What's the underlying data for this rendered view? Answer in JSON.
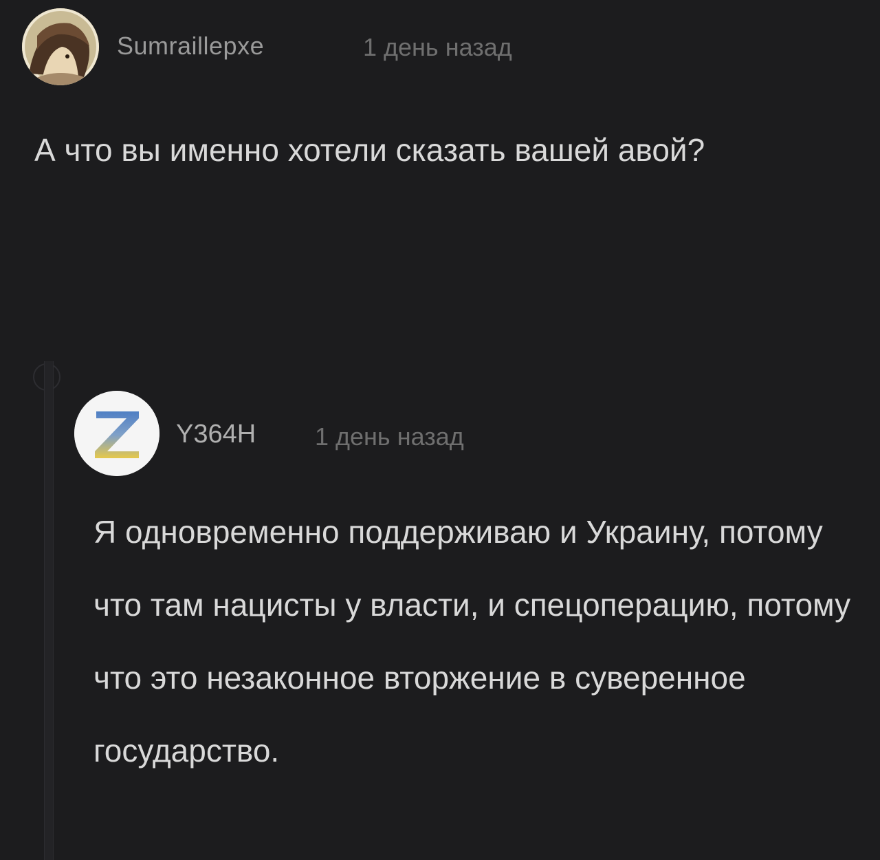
{
  "comments": [
    {
      "author": "Sumraillepxe",
      "time": "1 день назад",
      "avatar_icon": "anime-character-avatar",
      "text": "А что вы именно хотели сказать вашей авой?"
    },
    {
      "author": "Y364H",
      "time": "1 день назад",
      "avatar_icon": "letter-z-avatar",
      "avatar_colors": {
        "top": "#4f7fc4",
        "bottom": "#e6c84a"
      },
      "text": "Я одновременно поддерживаю и Украину, потому что там нацисты у власти, и спецоперацию, потому что это незаконное вторжение в суверенное государство."
    }
  ]
}
